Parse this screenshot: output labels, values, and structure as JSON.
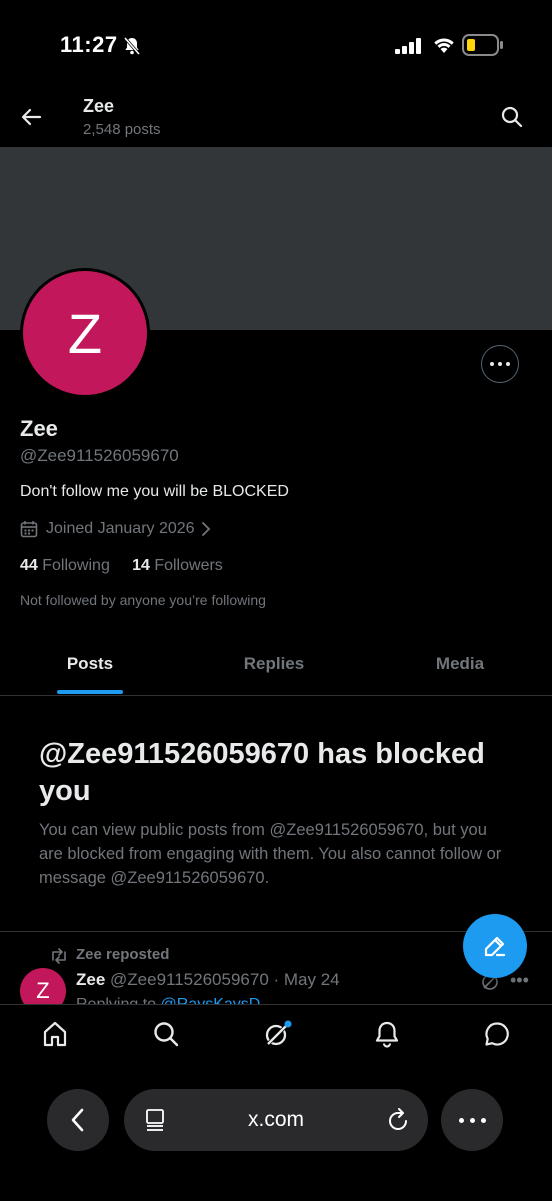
{
  "status_bar": {
    "time": "11:27"
  },
  "header": {
    "title": "Zee",
    "subtitle": "2,548 posts"
  },
  "profile": {
    "avatar_letter": "Z",
    "avatar_color": "#c2185b",
    "name": "Zee",
    "handle": "@Zee911526059670",
    "bio": "Don't follow me you will be BLOCKED",
    "joined": "Joined January 2026",
    "following_count": "44",
    "following_label": "Following",
    "followers_count": "14",
    "followers_label": "Followers",
    "not_followed": "Not followed by anyone you’re following"
  },
  "tabs": [
    {
      "label": "Posts",
      "active": true
    },
    {
      "label": "Replies",
      "active": false
    },
    {
      "label": "Media",
      "active": false
    }
  ],
  "blocked": {
    "title": "@Zee911526059670 has blocked you",
    "description": "You can view public posts from @Zee911526059670, but you are blocked from engaging with them. You also cannot follow or message @Zee911526059670."
  },
  "post": {
    "repost_label": "Zee reposted",
    "avatar_letter": "Z",
    "author_name": "Zee",
    "author_meta": "@Zee911526059670 · May 24",
    "reply_prefix": "Replying to",
    "reply_to": "@RaysKaysD..."
  },
  "bottom_nav": [
    "home-icon",
    "search-icon",
    "grok-icon",
    "notifications-icon",
    "messages-icon"
  ],
  "browser": {
    "url": "x.com"
  },
  "colors": {
    "accent": "#1d9bf0",
    "banner": "#333639",
    "background": "#000000"
  }
}
